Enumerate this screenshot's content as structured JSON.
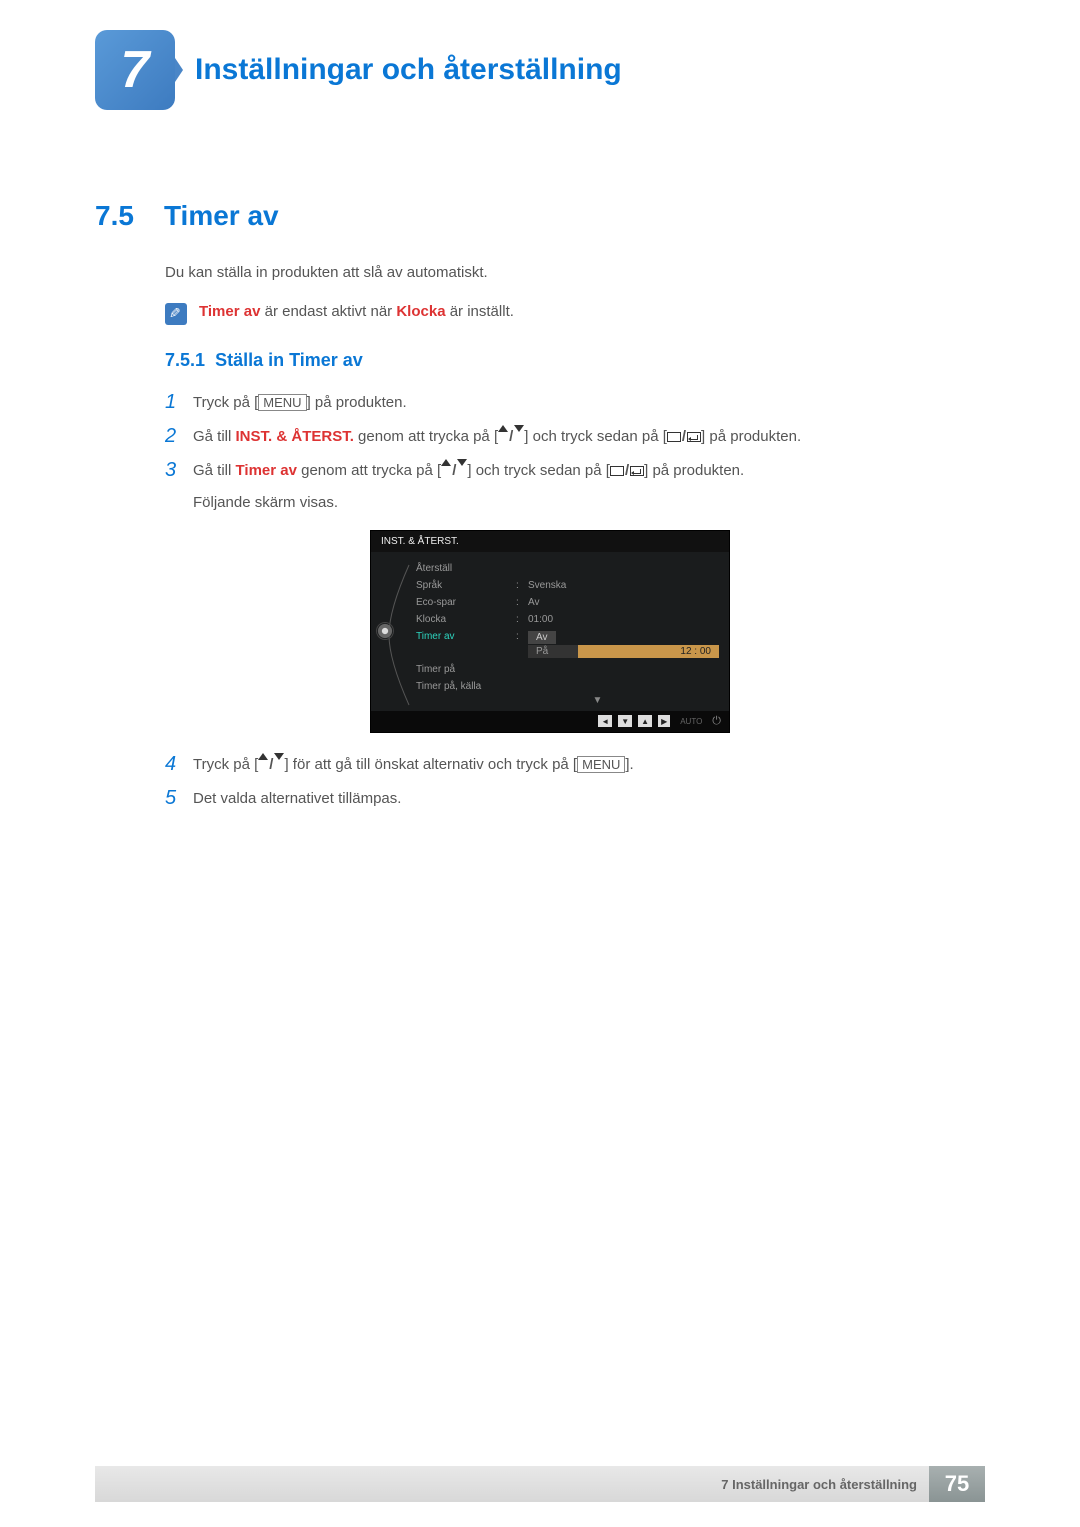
{
  "chapter": {
    "number": "7",
    "title": "Inställningar och återställning"
  },
  "section": {
    "number": "7.5",
    "title": "Timer av",
    "intro": "Du kan ställa in produkten att slå av automatiskt."
  },
  "note": {
    "prefix": "Timer av",
    "mid1": " är endast aktivt när ",
    "key": "Klocka",
    "mid2": " är inställt."
  },
  "subsection": {
    "number": "7.5.1",
    "title": "Ställa in Timer av"
  },
  "steps": {
    "s1": {
      "num": "1",
      "a": "Tryck på [",
      "menu": "MENU",
      "b": "] på produkten."
    },
    "s2": {
      "num": "2",
      "a": "Gå till ",
      "red": "INST. & ÅTERST.",
      "b": " genom att trycka på [",
      "c": "] och tryck sedan på [",
      "d": "] på produkten."
    },
    "s3": {
      "num": "3",
      "a": "Gå till ",
      "red": "Timer av",
      "b": " genom att trycka på [",
      "c": "] och tryck sedan på [",
      "d": "] på produkten.",
      "e": "Följande skärm visas."
    },
    "s4": {
      "num": "4",
      "a": "Tryck på [",
      "b": "] för att gå till önskat alternativ och tryck på [",
      "menu": "MENU",
      "c": "]."
    },
    "s5": {
      "num": "5",
      "a": "Det valda alternativet tillämpas."
    }
  },
  "osd": {
    "title": "INST. & ÅTERST.",
    "rows": [
      {
        "label": "Återställ",
        "value": ""
      },
      {
        "label": "Språk",
        "value": "Svenska"
      },
      {
        "label": "Eco-spar",
        "value": "Av"
      },
      {
        "label": "Klocka",
        "value": "01:00"
      },
      {
        "label": "Timer av",
        "value": ""
      },
      {
        "label": "Timer på",
        "value": ""
      },
      {
        "label": "Timer på, källa",
        "value": ""
      }
    ],
    "dropdown": {
      "opt1": "Av",
      "opt2": "På",
      "time": "12 : 00"
    },
    "footer_auto": "AUTO"
  },
  "footer": {
    "breadcrumb": "7 Inställningar och återställning",
    "page": "75"
  }
}
